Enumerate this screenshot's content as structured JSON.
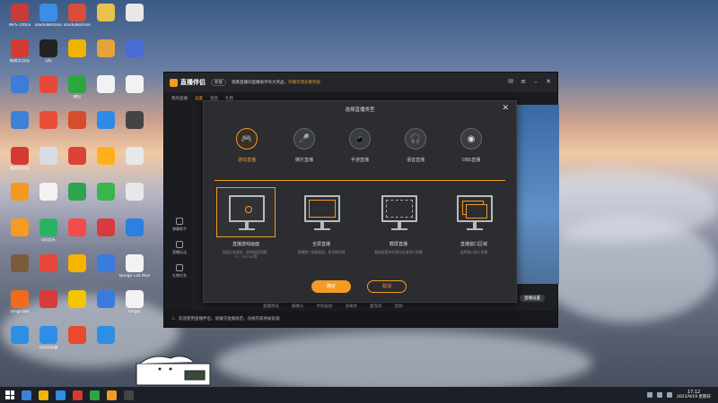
{
  "desktop_icons": [
    {
      "label": "WPS Office",
      "color": "#c73b3b",
      "icon": "wps-icon"
    },
    {
      "label": "BaiduNetdisk",
      "color": "#3a8ee6",
      "icon": "netdisk-icon"
    },
    {
      "label": "BaiduNetdisk",
      "color": "#d94d3a",
      "icon": "netdisk-icon"
    },
    {
      "label": "",
      "color": "#e8c24a",
      "icon": "folder-icon"
    },
    {
      "label": "",
      "color": "#e8e8e8",
      "icon": "doc-icon"
    },
    {
      "label": "网易云音乐",
      "color": "#d33a31",
      "icon": "music-icon"
    },
    {
      "label": "QQ",
      "color": "#222",
      "icon": "qq-icon"
    },
    {
      "label": "",
      "color": "#f0b400",
      "icon": "app-icon"
    },
    {
      "label": "",
      "color": "#e6a23c",
      "icon": "app-icon"
    },
    {
      "label": "",
      "color": "#4b6bd6",
      "icon": "app-icon"
    },
    {
      "label": "",
      "color": "#3b7dd8",
      "icon": "pc-icon"
    },
    {
      "label": "",
      "color": "#e5483b",
      "icon": "app-icon"
    },
    {
      "label": "微信",
      "color": "#2ca640",
      "icon": "wechat-icon"
    },
    {
      "label": "",
      "color": "#f2f2f2",
      "icon": "doc-icon"
    },
    {
      "label": "",
      "color": "#f2f2f2",
      "icon": "doc-icon"
    },
    {
      "label": "",
      "color": "#3b82d8",
      "icon": "app-icon"
    },
    {
      "label": "",
      "color": "#e84f37",
      "icon": "app-icon"
    },
    {
      "label": "",
      "color": "#d84b2b",
      "icon": "app-icon"
    },
    {
      "label": "",
      "color": "#2f8be6",
      "icon": "ie-icon"
    },
    {
      "label": "",
      "color": "#444",
      "icon": "app-icon"
    },
    {
      "label": "网易云音乐",
      "color": "#d33a31",
      "icon": "music-icon"
    },
    {
      "label": "",
      "color": "#d8dde5",
      "icon": "recycle-icon"
    },
    {
      "label": "",
      "color": "#d94437",
      "icon": "app-icon"
    },
    {
      "label": "",
      "color": "#ffb11b",
      "icon": "app-icon"
    },
    {
      "label": "",
      "color": "#e8e8e8",
      "icon": "doc-icon"
    },
    {
      "label": "",
      "color": "#f29a1f",
      "icon": "app-icon"
    },
    {
      "label": "",
      "color": "#f2f2f2",
      "icon": "doc-icon"
    },
    {
      "label": "",
      "color": "#2da44e",
      "icon": "app-icon"
    },
    {
      "label": "",
      "color": "#39b54a",
      "icon": "app-icon"
    },
    {
      "label": "",
      "color": "#e8e8e8",
      "icon": "doc-icon"
    },
    {
      "label": "",
      "color": "#f59a23",
      "icon": "app-icon"
    },
    {
      "label": "QQ音乐",
      "color": "#28b463",
      "icon": "music-icon"
    },
    {
      "label": "",
      "color": "#f14b4b",
      "icon": "app-icon"
    },
    {
      "label": "",
      "color": "#d83b3b",
      "icon": "app-icon"
    },
    {
      "label": "",
      "color": "#2d7fe0",
      "icon": "app-icon"
    },
    {
      "label": "",
      "color": "#7a5c3b",
      "icon": "game-icon"
    },
    {
      "label": "",
      "color": "#e6453a",
      "icon": "app-icon"
    },
    {
      "label": "",
      "color": "#f6b400",
      "icon": "app-icon"
    },
    {
      "label": "",
      "color": "#3a7be0",
      "icon": "app-icon"
    },
    {
      "label": "Bongo Cat Mver",
      "color": "#f2f2f2",
      "icon": "cat-icon"
    },
    {
      "label": "Originate",
      "color": "#f26b1d",
      "icon": "app-icon"
    },
    {
      "label": "",
      "color": "#d83b3b",
      "icon": "archive-icon"
    },
    {
      "label": "",
      "color": "#f5c400",
      "icon": "app-icon"
    },
    {
      "label": "",
      "color": "#3b7be0",
      "icon": "video-icon"
    },
    {
      "label": "Origin",
      "color": "#f2f2f2",
      "icon": "doc-icon"
    },
    {
      "label": "",
      "color": "#2d8ee6",
      "icon": "app-icon"
    },
    {
      "label": "QQ浏览器",
      "color": "#2d8ee6",
      "icon": "browser-icon"
    },
    {
      "label": "",
      "color": "#e84a2b",
      "icon": "app-icon"
    },
    {
      "label": "",
      "color": "#2d8ee6",
      "icon": "app-icon"
    }
  ],
  "app": {
    "name": "直播伴侣",
    "version_badge": "新版",
    "notice_prefix": "观看直播间直播助手有大奖品，",
    "notice_highlight": "开播可领多重奖励",
    "tabs": [
      "我的直播",
      "设置",
      "道具",
      "礼物"
    ],
    "left_rail": [
      "弹幕助手",
      "直播玩法",
      "礼物任务"
    ],
    "status_items": [
      "直播预览",
      "摄像头",
      "手机投屏",
      "多媒体",
      "麦克风",
      "音频"
    ],
    "bottom_text": "欢迎使用直播伴侣，请遵守直播规范，违规内容将被处理",
    "mini_button": "直播设置"
  },
  "dialog": {
    "title": "选择直播类型",
    "types": [
      {
        "label": "游戏直播",
        "icon": "gamepad-icon",
        "active": true
      },
      {
        "label": "娱乐直播",
        "icon": "microphone-icon",
        "active": false
      },
      {
        "label": "手游直播",
        "icon": "phone-icon",
        "active": false
      },
      {
        "label": "语音直播",
        "icon": "headphones-icon",
        "active": false
      },
      {
        "label": "OBS直播",
        "icon": "obs-icon",
        "active": false
      }
    ],
    "modes": [
      {
        "title": "直播游戏画面",
        "desc": "适配主流游戏，游戏画面直播，CF、DOTA2等",
        "active": true
      },
      {
        "title": "全屏直播",
        "desc": "直播整个屏幕画面，所见即所得",
        "active": false
      },
      {
        "title": "截屏直播",
        "desc": "截取屏幕中的部分区域进行直播",
        "active": false
      },
      {
        "title": "直播窗口区域",
        "desc": "选择窗口进行直播",
        "active": false
      }
    ],
    "ok_label": "确定",
    "cancel_label": "取消"
  },
  "taskbar": {
    "time": "17:12",
    "date": "2021/9/19 星期日"
  }
}
